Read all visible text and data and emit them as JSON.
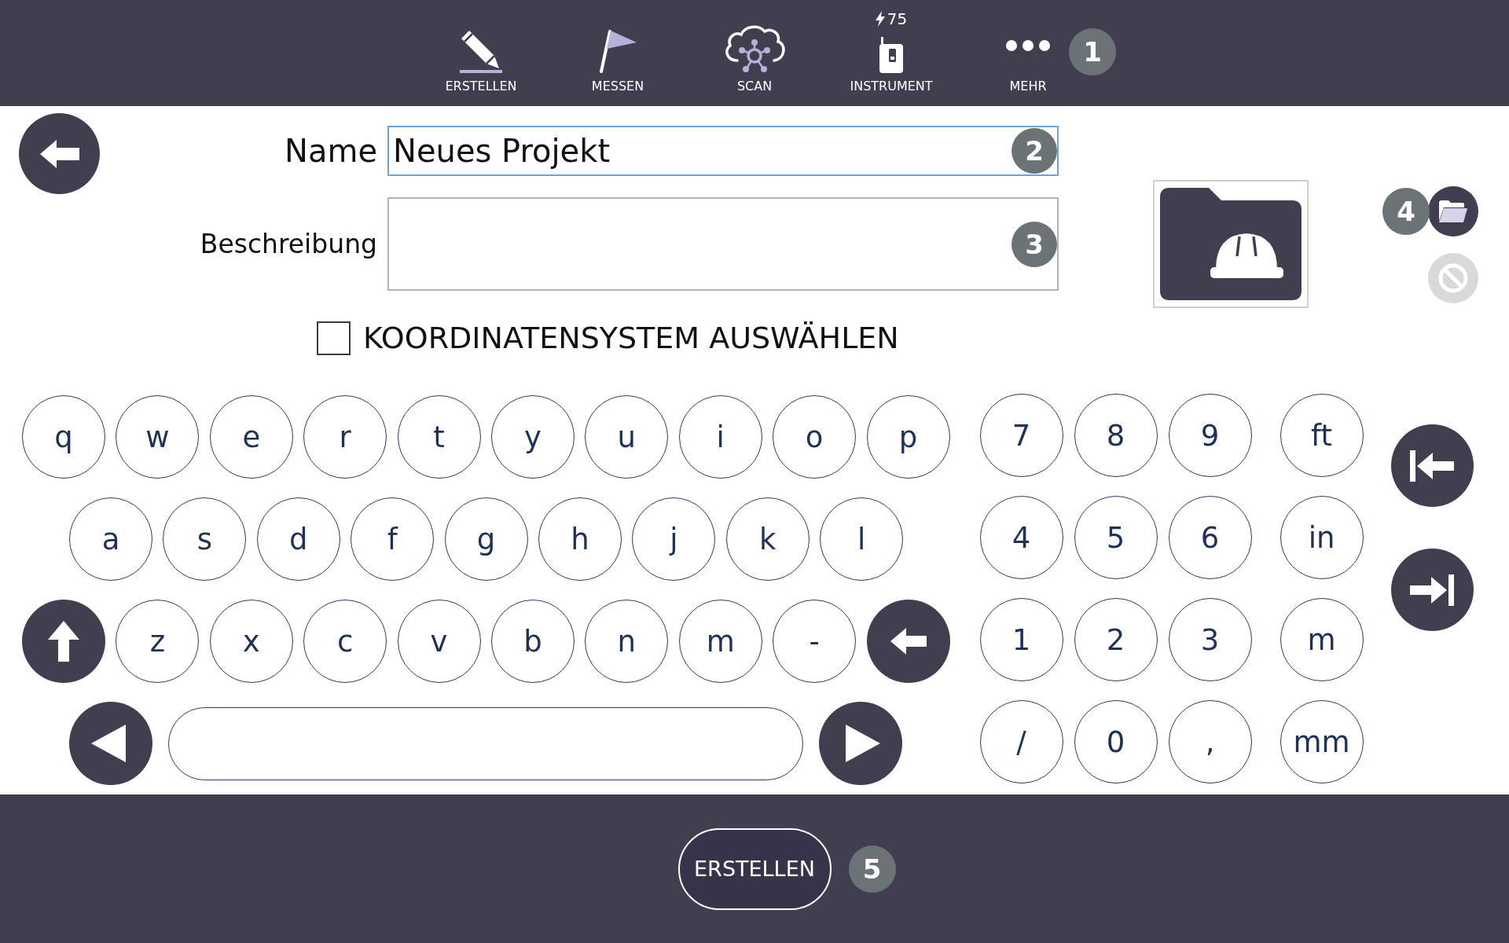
{
  "toolbar": {
    "items": [
      {
        "kind": "create",
        "label": "ERSTELLEN"
      },
      {
        "kind": "measure",
        "label": "MESSEN"
      },
      {
        "kind": "scan",
        "label": "SCAN"
      },
      {
        "kind": "instrument",
        "label": "INSTRUMENT",
        "charge": "75"
      },
      {
        "kind": "more",
        "label": "MEHR"
      }
    ],
    "callout": "1"
  },
  "form": {
    "name": {
      "label": "Name",
      "value": "Neues Projekt",
      "callout": "2"
    },
    "description": {
      "label": "Beschreibung",
      "callout": "3"
    },
    "coordinate_system": {
      "label": "KOORDINATENSYSTEM AUSWÄHLEN",
      "checked": false
    }
  },
  "side_tools": {
    "callout": "4",
    "buttons": [
      {
        "kind": "open_folder",
        "disabled": false
      },
      {
        "kind": "clear",
        "disabled": true
      }
    ]
  },
  "keyboard": {
    "letter_rows": [
      [
        {
          "kind": "char",
          "label": "q"
        },
        {
          "kind": "char",
          "label": "w"
        },
        {
          "kind": "char",
          "label": "e"
        },
        {
          "kind": "char",
          "label": "r"
        },
        {
          "kind": "char",
          "label": "t"
        },
        {
          "kind": "char",
          "label": "y"
        },
        {
          "kind": "char",
          "label": "u"
        },
        {
          "kind": "char",
          "label": "i"
        },
        {
          "kind": "char",
          "label": "o"
        },
        {
          "kind": "char",
          "label": "p"
        }
      ],
      [
        {
          "kind": "char",
          "label": "a"
        },
        {
          "kind": "char",
          "label": "s"
        },
        {
          "kind": "char",
          "label": "d"
        },
        {
          "kind": "char",
          "label": "f"
        },
        {
          "kind": "char",
          "label": "g"
        },
        {
          "kind": "char",
          "label": "h"
        },
        {
          "kind": "char",
          "label": "j"
        },
        {
          "kind": "char",
          "label": "k"
        },
        {
          "kind": "char",
          "label": "l"
        }
      ],
      [
        {
          "kind": "shift"
        },
        {
          "kind": "char",
          "label": "z"
        },
        {
          "kind": "char",
          "label": "x"
        },
        {
          "kind": "char",
          "label": "c"
        },
        {
          "kind": "char",
          "label": "v"
        },
        {
          "kind": "char",
          "label": "b"
        },
        {
          "kind": "char",
          "label": "n"
        },
        {
          "kind": "char",
          "label": "m"
        },
        {
          "kind": "char",
          "label": "-"
        },
        {
          "kind": "backspace"
        }
      ],
      [
        {
          "kind": "cursor_left"
        },
        {
          "kind": "space"
        },
        {
          "kind": "cursor_right"
        }
      ]
    ],
    "digits": [
      {
        "kind": "char",
        "label": "7"
      },
      {
        "kind": "char",
        "label": "8"
      },
      {
        "kind": "char",
        "label": "9"
      },
      {
        "kind": "char",
        "label": "4"
      },
      {
        "kind": "char",
        "label": "5"
      },
      {
        "kind": "char",
        "label": "6"
      },
      {
        "kind": "char",
        "label": "1"
      },
      {
        "kind": "char",
        "label": "2"
      },
      {
        "kind": "char",
        "label": "3"
      },
      {
        "kind": "char",
        "label": "/"
      },
      {
        "kind": "char",
        "label": "0"
      },
      {
        "kind": "char",
        "label": ","
      }
    ],
    "units": [
      {
        "kind": "unit",
        "label": "ft"
      },
      {
        "kind": "unit",
        "label": "in"
      },
      {
        "kind": "unit",
        "label": "m"
      },
      {
        "kind": "unit",
        "label": "mm"
      }
    ],
    "navigation": [
      {
        "kind": "field_previous"
      },
      {
        "kind": "field_next"
      }
    ]
  },
  "footer": {
    "button": {
      "label": "ERSTELLEN"
    },
    "callout": "5"
  }
}
